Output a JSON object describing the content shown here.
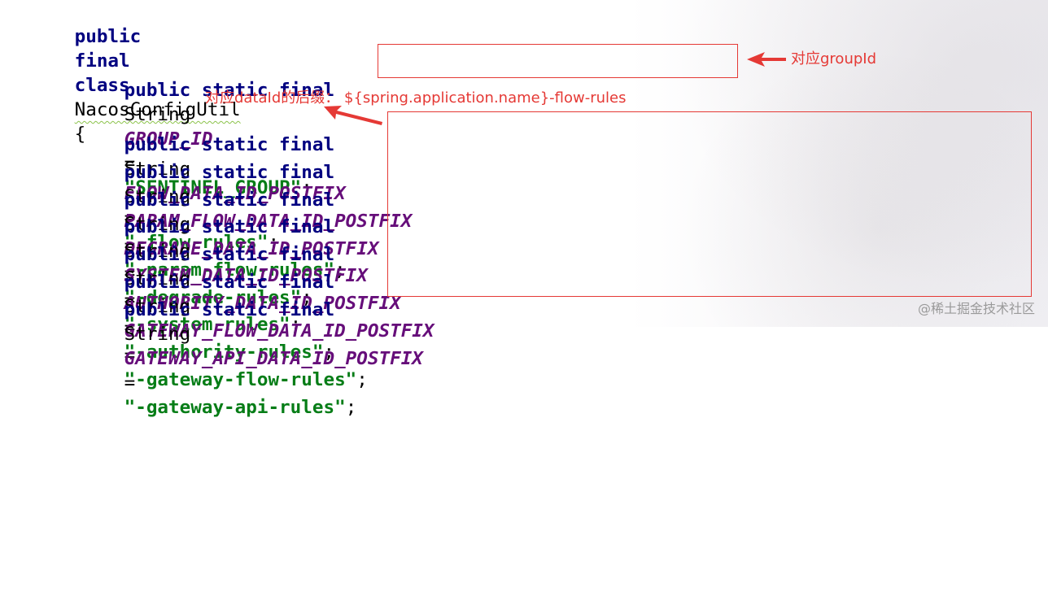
{
  "code": {
    "class_decl": {
      "kw1": "public",
      "kw2": "final",
      "kw3": "class",
      "class_name": "NacosConfigUtil",
      "brace": "{"
    },
    "fields": [
      {
        "mods": "public static final",
        "type": "String",
        "name": "GROUP_ID",
        "value": "\"SENTINEL_GROUP\""
      },
      {
        "mods": "public static final",
        "type": "String",
        "name": "FLOW_DATA_ID_POSTFIX",
        "value": "\"-flow-rules\""
      },
      {
        "mods": "public static final",
        "type": "String",
        "name": "PARAM_FLOW_DATA_ID_POSTFIX",
        "value": "\"-param-flow-rules\""
      },
      {
        "mods": "public static final",
        "type": "String",
        "name": "DEGRADE_DATA_ID_POSTFIX",
        "value": "\"-degrade-rules\""
      },
      {
        "mods": "public static final",
        "type": "String",
        "name": "SYSTEM_DATA_ID_POSTFIX",
        "value": "\"-system-rules\""
      },
      {
        "mods": "public static final",
        "type": "String",
        "name": "AUTHORITY_DATA_ID_POSTFIX",
        "value": "\"-authority-rules\""
      },
      {
        "mods": "public static final",
        "type": "String",
        "name": "GATEWAY_FLOW_DATA_ID_POSTFIX",
        "value": "\"-gateway-flow-rules\""
      },
      {
        "mods": "public static final",
        "type": "String",
        "name": "GATEWAY_API_DATA_ID_POSTFIX",
        "value": "\"-gateway-api-rules\""
      }
    ]
  },
  "annotations": {
    "group_note": "对应groupId",
    "dataid_note": "对应dataId的后缀：  ${spring.application.name}-flow-rules"
  },
  "watermark": "@稀土掘金技术社区",
  "colors": {
    "keyword": "#000080",
    "constant": "#660e7a",
    "string": "#067d17",
    "annotation": "#e53935"
  }
}
